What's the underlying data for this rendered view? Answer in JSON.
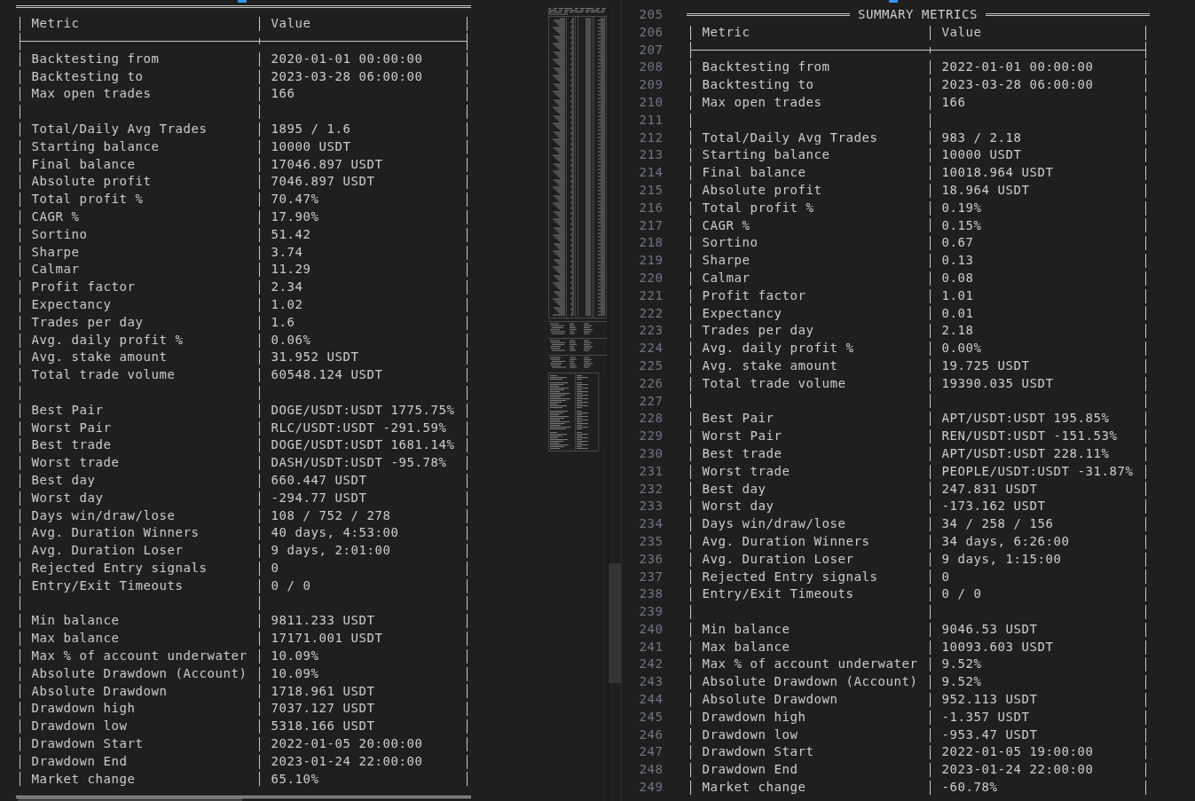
{
  "left_editor": {
    "columns": [
      "Metric",
      "Value"
    ],
    "sections": [
      [
        {
          "metric": "Backtesting from",
          "value": "2020-01-01 00:00:00"
        },
        {
          "metric": "Backtesting to",
          "value": "2023-03-28 06:00:00"
        },
        {
          "metric": "Max open trades",
          "value": "166"
        }
      ],
      [
        {
          "metric": "Total/Daily Avg Trades",
          "value": "1895 / 1.6"
        },
        {
          "metric": "Starting balance",
          "value": "10000 USDT"
        },
        {
          "metric": "Final balance",
          "value": "17046.897 USDT"
        },
        {
          "metric": "Absolute profit",
          "value": "7046.897 USDT"
        },
        {
          "metric": "Total profit %",
          "value": "70.47%"
        },
        {
          "metric": "CAGR %",
          "value": "17.90%"
        },
        {
          "metric": "Sortino",
          "value": "51.42"
        },
        {
          "metric": "Sharpe",
          "value": "3.74"
        },
        {
          "metric": "Calmar",
          "value": "11.29"
        },
        {
          "metric": "Profit factor",
          "value": "2.34"
        },
        {
          "metric": "Expectancy",
          "value": "1.02"
        },
        {
          "metric": "Trades per day",
          "value": "1.6"
        },
        {
          "metric": "Avg. daily profit %",
          "value": "0.06%"
        },
        {
          "metric": "Avg. stake amount",
          "value": "31.952 USDT"
        },
        {
          "metric": "Total trade volume",
          "value": "60548.124 USDT"
        }
      ],
      [
        {
          "metric": "Best Pair",
          "value": "DOGE/USDT:USDT 1775.75%"
        },
        {
          "metric": "Worst Pair",
          "value": "RLC/USDT:USDT -291.59%"
        },
        {
          "metric": "Best trade",
          "value": "DOGE/USDT:USDT 1681.14%"
        },
        {
          "metric": "Worst trade",
          "value": "DASH/USDT:USDT -95.78%"
        },
        {
          "metric": "Best day",
          "value": "660.447 USDT"
        },
        {
          "metric": "Worst day",
          "value": "-294.77 USDT"
        },
        {
          "metric": "Days win/draw/lose",
          "value": "108 / 752 / 278"
        },
        {
          "metric": "Avg. Duration Winners",
          "value": "40 days, 4:53:00"
        },
        {
          "metric": "Avg. Duration Loser",
          "value": "9 days, 2:01:00"
        },
        {
          "metric": "Rejected Entry signals",
          "value": "0"
        },
        {
          "metric": "Entry/Exit Timeouts",
          "value": "0 / 0"
        }
      ],
      [
        {
          "metric": "Min balance",
          "value": "9811.233 USDT"
        },
        {
          "metric": "Max balance",
          "value": "17171.001 USDT"
        },
        {
          "metric": "Max % of account underwater",
          "value": "10.09%"
        },
        {
          "metric": "Absolute Drawdown (Account)",
          "value": "10.09%"
        },
        {
          "metric": "Absolute Drawdown",
          "value": "1718.961 USDT"
        },
        {
          "metric": "Drawdown high",
          "value": "7037.127 USDT"
        },
        {
          "metric": "Drawdown low",
          "value": "5318.166 USDT"
        },
        {
          "metric": "Drawdown Start",
          "value": "2022-01-05 20:00:00"
        },
        {
          "metric": "Drawdown End",
          "value": "2023-01-24 22:00:00"
        },
        {
          "metric": "Market change",
          "value": "65.10%"
        }
      ]
    ]
  },
  "right_editor": {
    "line_numbers": [
      "205",
      "206",
      "207",
      "208",
      "209",
      "210",
      "211",
      "212",
      "213",
      "214",
      "215",
      "216",
      "217",
      "218",
      "219",
      "220",
      "221",
      "222",
      "223",
      "224",
      "225",
      "226",
      "227",
      "228",
      "229",
      "230",
      "231",
      "232",
      "233",
      "234",
      "235",
      "236",
      "237",
      "238",
      "239",
      "240",
      "241",
      "242",
      "243",
      "244",
      "245",
      "246",
      "247",
      "248",
      "249"
    ],
    "title": "SUMMARY METRICS",
    "columns": [
      "Metric",
      "Value"
    ],
    "sections": [
      [
        {
          "metric": "Backtesting from",
          "value": "2022-01-01 00:00:00"
        },
        {
          "metric": "Backtesting to",
          "value": "2023-03-28 06:00:00"
        },
        {
          "metric": "Max open trades",
          "value": "166"
        }
      ],
      [
        {
          "metric": "Total/Daily Avg Trades",
          "value": "983 / 2.18"
        },
        {
          "metric": "Starting balance",
          "value": "10000 USDT"
        },
        {
          "metric": "Final balance",
          "value": "10018.964 USDT"
        },
        {
          "metric": "Absolute profit",
          "value": "18.964 USDT"
        },
        {
          "metric": "Total profit %",
          "value": "0.19%"
        },
        {
          "metric": "CAGR %",
          "value": "0.15%"
        },
        {
          "metric": "Sortino",
          "value": "0.67"
        },
        {
          "metric": "Sharpe",
          "value": "0.13"
        },
        {
          "metric": "Calmar",
          "value": "0.08"
        },
        {
          "metric": "Profit factor",
          "value": "1.01"
        },
        {
          "metric": "Expectancy",
          "value": "0.01"
        },
        {
          "metric": "Trades per day",
          "value": "2.18"
        },
        {
          "metric": "Avg. daily profit %",
          "value": "0.00%"
        },
        {
          "metric": "Avg. stake amount",
          "value": "19.725 USDT"
        },
        {
          "metric": "Total trade volume",
          "value": "19390.035 USDT"
        }
      ],
      [
        {
          "metric": "Best Pair",
          "value": "APT/USDT:USDT 195.85%"
        },
        {
          "metric": "Worst Pair",
          "value": "REN/USDT:USDT -151.53%"
        },
        {
          "metric": "Best trade",
          "value": "APT/USDT:USDT 228.11%"
        },
        {
          "metric": "Worst trade",
          "value": "PEOPLE/USDT:USDT -31.87%"
        },
        {
          "metric": "Best day",
          "value": "247.831 USDT"
        },
        {
          "metric": "Worst day",
          "value": "-173.162 USDT"
        },
        {
          "metric": "Days win/draw/lose",
          "value": "34 / 258 / 156"
        },
        {
          "metric": "Avg. Duration Winners",
          "value": "34 days, 6:26:00"
        },
        {
          "metric": "Avg. Duration Loser",
          "value": "9 days, 1:15:00"
        },
        {
          "metric": "Rejected Entry signals",
          "value": "0"
        },
        {
          "metric": "Entry/Exit Timeouts",
          "value": "0 / 0"
        }
      ],
      [
        {
          "metric": "Min balance",
          "value": "9046.53 USDT"
        },
        {
          "metric": "Max balance",
          "value": "10093.603 USDT"
        },
        {
          "metric": "Max % of account underwater",
          "value": "9.52%"
        },
        {
          "metric": "Absolute Drawdown (Account)",
          "value": "9.52%"
        },
        {
          "metric": "Absolute Drawdown",
          "value": "952.113 USDT"
        },
        {
          "metric": "Drawdown high",
          "value": "-1.357 USDT"
        },
        {
          "metric": "Drawdown low",
          "value": "-953.47 USDT"
        },
        {
          "metric": "Drawdown Start",
          "value": "2022-01-05 19:00:00"
        },
        {
          "metric": "Drawdown End",
          "value": "2023-01-24 22:00:00"
        },
        {
          "metric": "Market change",
          "value": "-60.78%"
        }
      ]
    ]
  }
}
